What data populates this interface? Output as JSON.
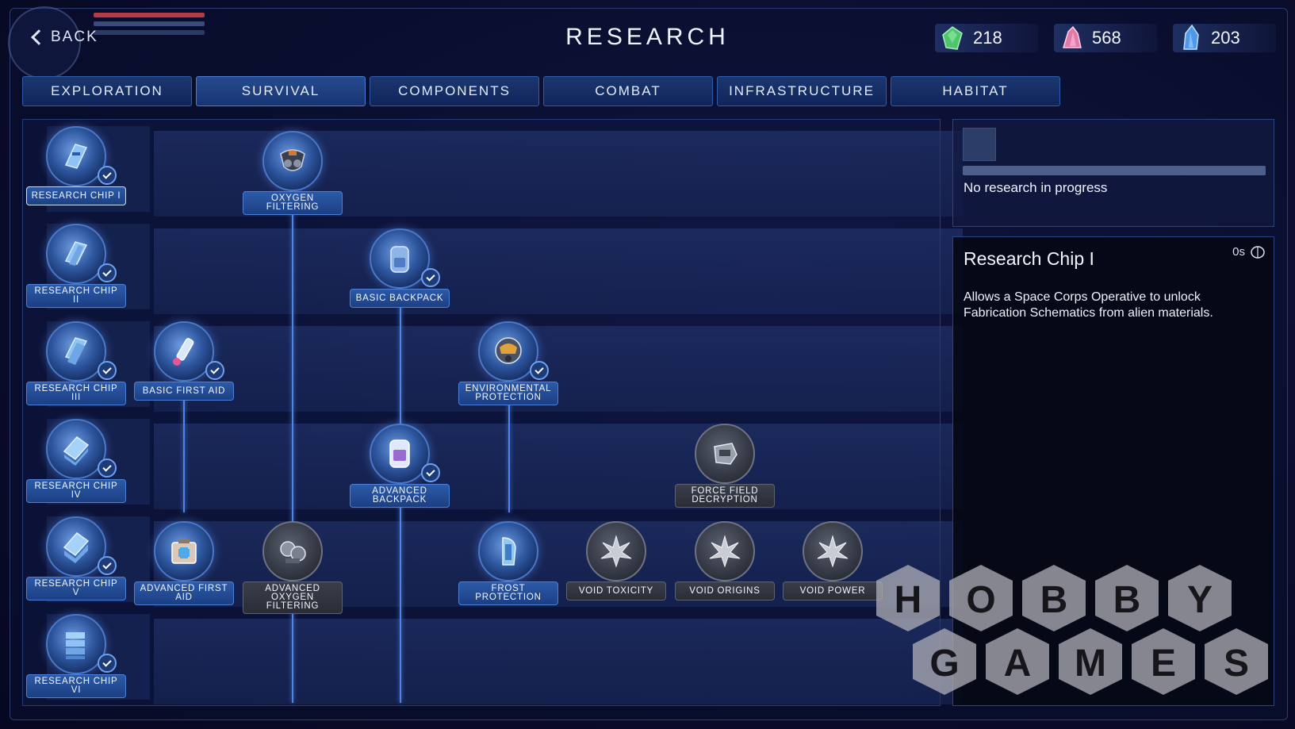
{
  "header": {
    "back_label": "BACK",
    "title": "RESEARCH",
    "resources": [
      {
        "icon": "green-crystal-icon",
        "color": "#5ed07a",
        "value": "218"
      },
      {
        "icon": "pink-crystal-icon",
        "color": "#e98cb8",
        "value": "568"
      },
      {
        "icon": "blue-crystal-icon",
        "color": "#5aa8f0",
        "value": "203"
      }
    ]
  },
  "tabs": [
    {
      "label": "EXPLORATION",
      "active": false
    },
    {
      "label": "SURVIVAL",
      "active": true
    },
    {
      "label": "COMPONENTS",
      "active": false
    },
    {
      "label": "COMBAT",
      "active": false
    },
    {
      "label": "INFRASTRUCTURE",
      "active": false
    },
    {
      "label": "HABITAT",
      "active": false
    }
  ],
  "tree": {
    "nodes": [
      {
        "id": "research-chip-1",
        "label": "RESEARCH CHIP I",
        "researched": true,
        "locked": false,
        "selected": true,
        "icon": "research-chip-icon"
      },
      {
        "id": "research-chip-2",
        "label": "RESEARCH CHIP II",
        "researched": true,
        "locked": false,
        "icon": "research-chip-icon"
      },
      {
        "id": "research-chip-3",
        "label": "RESEARCH CHIP III",
        "researched": true,
        "locked": false,
        "icon": "research-chip-icon"
      },
      {
        "id": "research-chip-4",
        "label": "RESEARCH CHIP IV",
        "researched": true,
        "locked": false,
        "icon": "research-chip-icon"
      },
      {
        "id": "research-chip-5",
        "label": "RESEARCH CHIP V",
        "researched": true,
        "locked": false,
        "icon": "research-chip-icon"
      },
      {
        "id": "research-chip-6",
        "label": "RESEARCH CHIP VI",
        "researched": true,
        "locked": false,
        "icon": "research-chip-icon"
      },
      {
        "id": "oxygen-filtering",
        "label": "OXYGEN FILTERING",
        "researched": false,
        "locked": false,
        "icon": "oxygen-mask-icon"
      },
      {
        "id": "basic-backpack",
        "label": "BASIC BACKPACK",
        "researched": true,
        "locked": false,
        "icon": "backpack-icon"
      },
      {
        "id": "basic-first-aid",
        "label": "BASIC FIRST AID",
        "researched": true,
        "locked": false,
        "icon": "syringe-icon"
      },
      {
        "id": "environmental-protection",
        "label": "ENVIRONMENTAL PROTECTION",
        "researched": true,
        "locked": false,
        "icon": "helmet-icon"
      },
      {
        "id": "advanced-backpack",
        "label": "ADVANCED BACKPACK",
        "researched": true,
        "locked": false,
        "icon": "backpack-icon"
      },
      {
        "id": "force-field-decryption",
        "label": "FORCE FIELD DECRYPTION",
        "researched": false,
        "locked": true,
        "icon": "force-field-icon"
      },
      {
        "id": "advanced-first-aid",
        "label": "ADVANCED FIRST AID",
        "researched": false,
        "locked": false,
        "icon": "medkit-icon"
      },
      {
        "id": "advanced-oxygen-filtering",
        "label": "ADVANCED OXYGEN FILTERING",
        "researched": false,
        "locked": true,
        "icon": "oxygen-tank-icon"
      },
      {
        "id": "frost-protection",
        "label": "FROST PROTECTION",
        "researched": false,
        "locked": false,
        "icon": "frost-suit-icon"
      },
      {
        "id": "void-toxicity",
        "label": "VOID TOXICITY",
        "researched": false,
        "locked": true,
        "icon": "void-crystal-icon"
      },
      {
        "id": "void-origins",
        "label": "VOID ORIGINS",
        "researched": false,
        "locked": true,
        "icon": "void-crystal-icon"
      },
      {
        "id": "void-power",
        "label": "VOID POWER",
        "researched": false,
        "locked": true,
        "icon": "void-crystal-icon"
      }
    ]
  },
  "progress": {
    "text": "No research in progress",
    "value": 0
  },
  "detail": {
    "title": "Research Chip I",
    "time": "0s",
    "time_icon": "brain-icon",
    "description": "Allows a Space Corps Operative to unlock Fabrication Schematics from alien materials."
  },
  "watermark": {
    "line1": "HOBBY",
    "line2": "GAMES"
  }
}
